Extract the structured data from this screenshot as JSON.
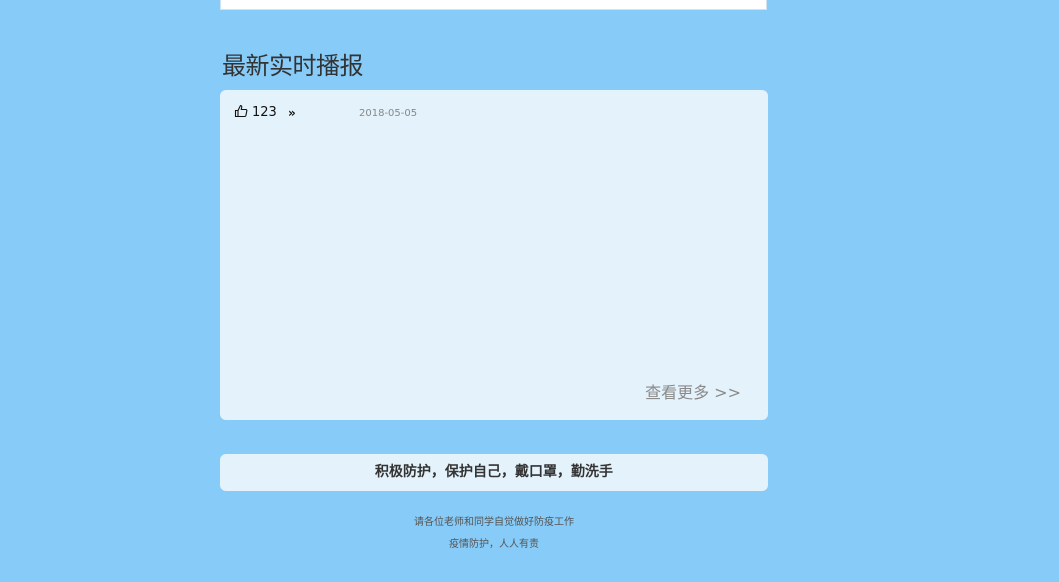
{
  "section": {
    "title": "最新实时播报"
  },
  "news": {
    "like_icon": "thumbs-up-icon",
    "like_count": "123",
    "arrow_icon": "double-chevron-right-icon",
    "arrow_glyph": "»",
    "date": "2018-05-05",
    "view_more": "查看更多 >>"
  },
  "banner": {
    "slogan": "积极防护，保护自己，戴口罩，勤洗手"
  },
  "footer": {
    "line1": "请各位老师和同学自觉做好防疫工作",
    "line2": "疫情防护，人人有责"
  },
  "colors": {
    "page_background": "#87cbf8",
    "card_background": "#e4f2fb",
    "title_text": "#333333",
    "muted_text": "#8a8a8a"
  }
}
